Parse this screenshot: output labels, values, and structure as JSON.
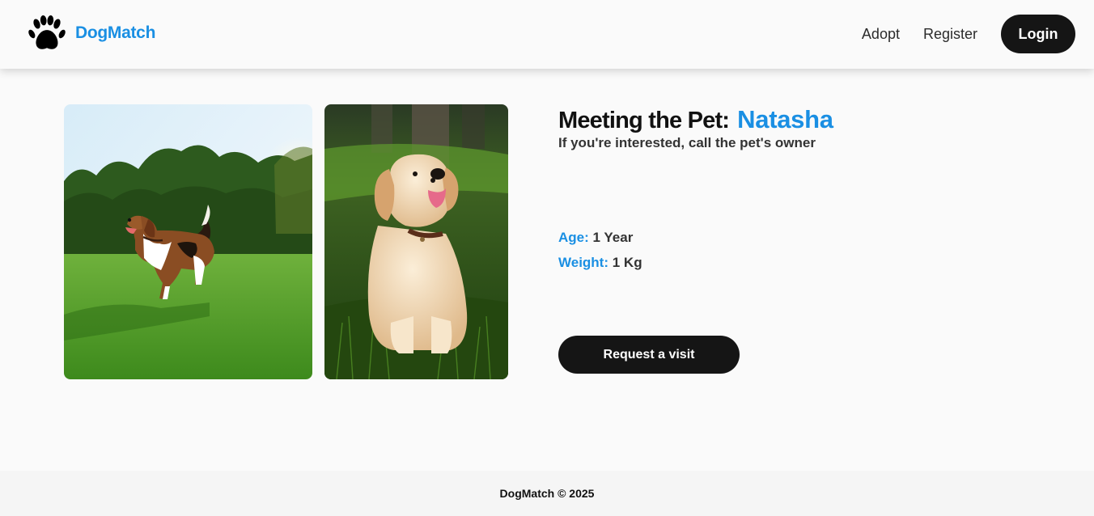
{
  "header": {
    "logo_icon": "paw-icon",
    "brand": "DogMatch",
    "nav": [
      {
        "label": "Adopt"
      },
      {
        "label": "Register"
      }
    ],
    "login_label": "Login"
  },
  "gallery": {
    "images": [
      {
        "icon": "beagle-photo",
        "alt": "Beagle running on grass"
      },
      {
        "icon": "golden-puppy-photo",
        "alt": "Golden retriever puppy sitting on grass"
      }
    ]
  },
  "pet": {
    "title_prefix": "Meeting the Pet:",
    "name": "Natasha",
    "subtitle": "If you're interested, call the pet's owner",
    "attributes": {
      "age_label": "Age:",
      "age_value": "1 Year",
      "weight_label": "Weight:",
      "weight_value": "1 Kg"
    },
    "request_label": "Request a visit"
  },
  "footer": {
    "text": "DogMatch © 2025"
  },
  "colors": {
    "accent": "#1a8fe3",
    "button": "#151515",
    "background": "#fafafa"
  }
}
